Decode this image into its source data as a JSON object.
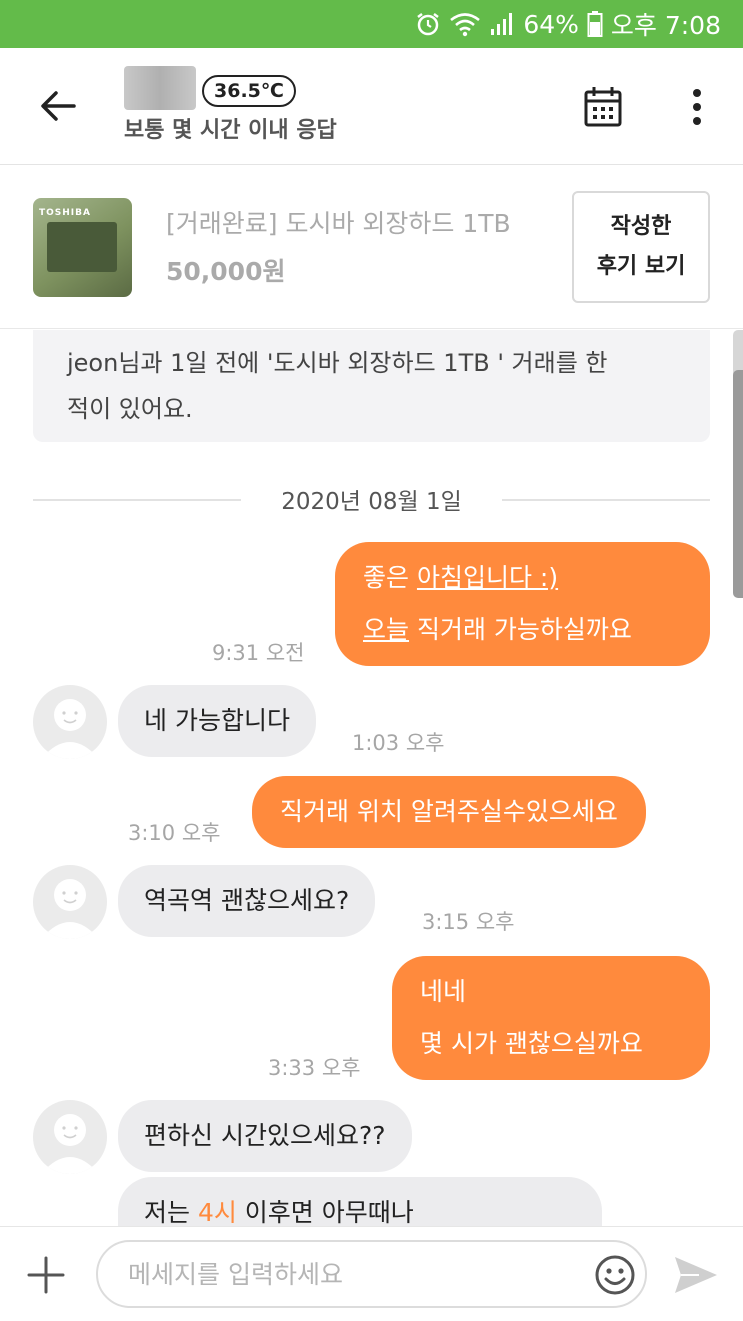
{
  "status_bar": {
    "battery": "64%",
    "time": "오후 7:08",
    "icons": [
      "alarm-icon",
      "wifi-icon",
      "signal-icon",
      "battery-icon"
    ]
  },
  "header": {
    "temperature": "36.5℃",
    "response_text": "보통 몇 시간 이내 응답",
    "icons": [
      "back-arrow-icon",
      "calendar-icon",
      "more-vertical-icon"
    ]
  },
  "product": {
    "thumb_brand": "TOSHIBA",
    "title": "[거래완료] 도시바 외장하드 1TB",
    "price": "50,000원",
    "review_button_line1": "작성한",
    "review_button_line2": "후기 보기"
  },
  "notice": {
    "line1": "jeon님과 1일 전에 '도시바 외장하드 1TB ' 거래를 한",
    "line2": "적이 있어요."
  },
  "date_divider": "2020년 08월 1일",
  "messages": [
    {
      "from": "me",
      "line1_a": "좋은 ",
      "line1_b": "아침입니다 :)",
      "line2_a": "오늘",
      "line2_b": " 직거래 가능하실까요",
      "time": "9:31 오전"
    },
    {
      "from": "them",
      "text": "네 가능합니다",
      "time": "1:03 오후"
    },
    {
      "from": "me",
      "text": "직거래 위치 알려주실수있으세요",
      "time": "3:10 오후"
    },
    {
      "from": "them",
      "text": "역곡역 괜찮으세요?",
      "time": "3:15 오후"
    },
    {
      "from": "me",
      "line1": "네네",
      "line2": "몇 시가 괜찮으실까요",
      "time": "3:33 오후"
    },
    {
      "from": "them",
      "text": "편하신 시간있으세요??"
    },
    {
      "from": "them",
      "text_a": "저는 ",
      "text_b": "4시",
      "text_c": " 이후면 아무때나"
    }
  ],
  "input_bar": {
    "placeholder": "메세지를 입력하세요",
    "icons": [
      "plus-icon",
      "emoji-icon",
      "send-icon"
    ]
  },
  "colors": {
    "status_bar": "#63bb4a",
    "my_bubble": "#ff8a3d",
    "their_bubble": "#ececee"
  }
}
